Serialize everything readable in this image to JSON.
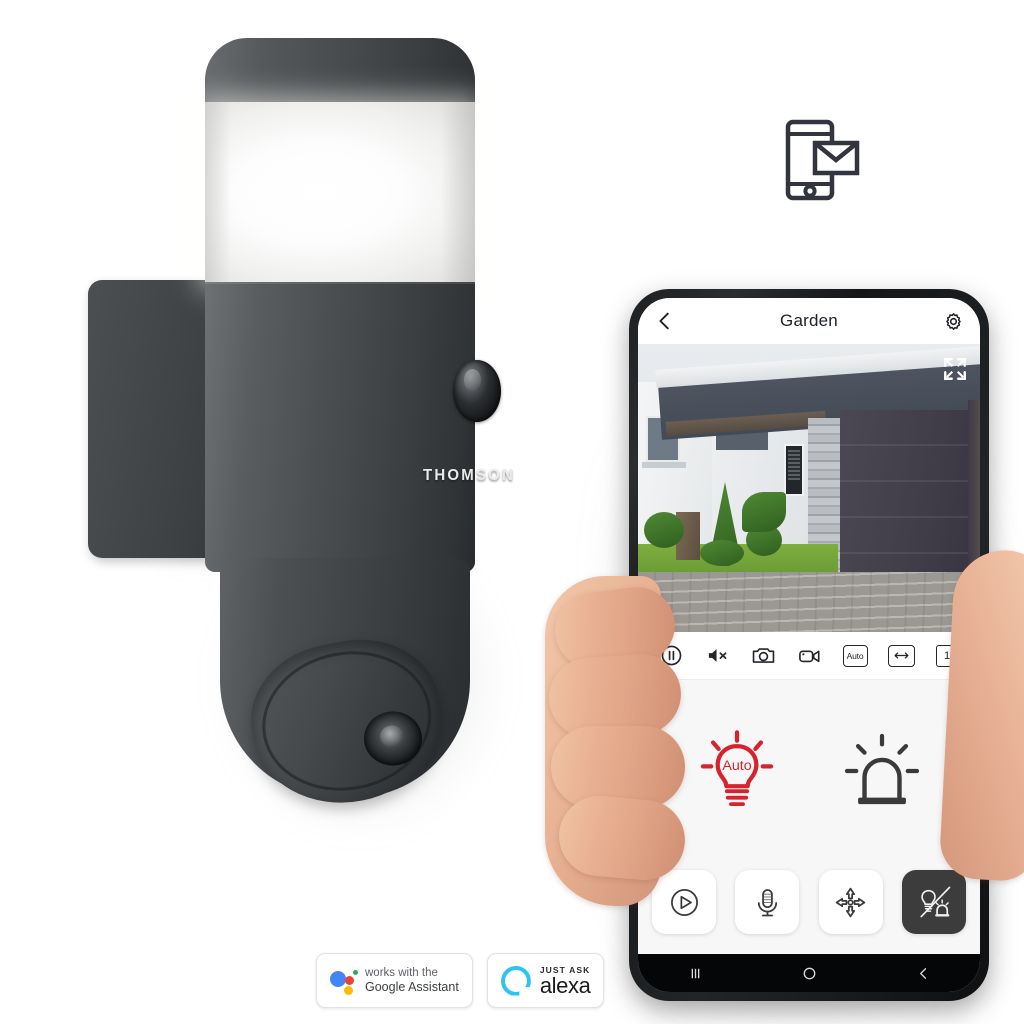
{
  "product": {
    "brand": "THOMSON",
    "device_name": "outdoor-wall-light-camera"
  },
  "notification": {
    "icon": "phone-envelope-notification-icon"
  },
  "app": {
    "header": {
      "back_icon": "chevron-left-icon",
      "title": "Garden",
      "settings_icon": "gear-icon"
    },
    "video": {
      "fullscreen_icon": "fullscreen-expand-icon",
      "scene": "house-driveway-garage-live-view"
    },
    "controls": [
      {
        "name": "pause-button",
        "icon": "pause-circle-icon",
        "label": ""
      },
      {
        "name": "mute-button",
        "icon": "speaker-mute-icon",
        "label": ""
      },
      {
        "name": "snapshot-button",
        "icon": "photo-camera-icon",
        "label": ""
      },
      {
        "name": "record-button",
        "icon": "video-camera-icon",
        "label": ""
      },
      {
        "name": "quality-button",
        "icon": "quality-badge",
        "label": "Auto"
      },
      {
        "name": "aspect-button",
        "icon": "resize-horizontal-icon",
        "label": ""
      },
      {
        "name": "zoom-level-button",
        "icon": "zoom-level-badge",
        "label": "1"
      }
    ],
    "actions": [
      {
        "name": "auto-light-toggle",
        "icon": "light-bulb-auto-icon",
        "label": "Auto",
        "color": "#D8232F",
        "state": "active"
      },
      {
        "name": "siren-toggle",
        "icon": "siren-alarm-icon",
        "label": "",
        "color": "#3a3a3a",
        "state": "inactive"
      }
    ],
    "bottom_buttons": [
      {
        "name": "playback-button",
        "icon": "play-circle-icon",
        "state": "inactive"
      },
      {
        "name": "talk-button",
        "icon": "microphone-icon",
        "state": "inactive"
      },
      {
        "name": "pan-tilt-button",
        "icon": "four-arrows-move-icon",
        "state": "inactive"
      },
      {
        "name": "light-siren-off-button",
        "icon": "light-siren-slash-icon",
        "state": "active"
      }
    ],
    "nav_bar": [
      {
        "name": "recents-button",
        "icon": "recents-bars-icon"
      },
      {
        "name": "home-button",
        "icon": "home-circle-icon"
      },
      {
        "name": "back-button",
        "icon": "back-chevron-icon"
      }
    ]
  },
  "badges": {
    "google": {
      "line1": "works with the",
      "line2": "Google Assistant",
      "colors": {
        "blue": "#4285F4",
        "red": "#EA4335",
        "yellow": "#FBBC05",
        "green": "#34A853"
      }
    },
    "alexa": {
      "line1": "JUST ASK",
      "line2": "alexa",
      "color": "#31C3F0"
    }
  }
}
